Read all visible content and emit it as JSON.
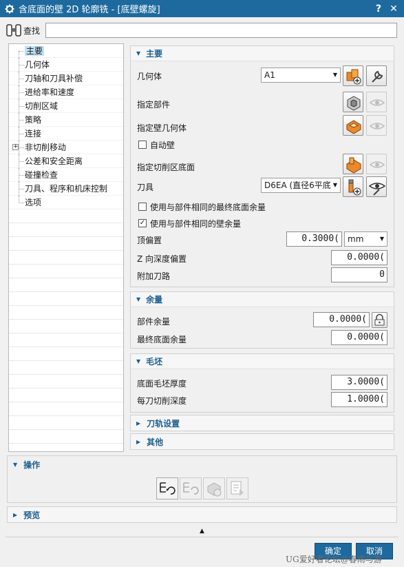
{
  "window": {
    "title": "含底面的壁 2D 轮廓铣 - [底壁螺旋]",
    "help_label": "?",
    "close_label": "✕",
    "gear_icon": "gear-icon"
  },
  "search": {
    "label": "查找",
    "value": ""
  },
  "nav": {
    "items": [
      {
        "label": "主要",
        "selected": true
      },
      {
        "label": "几何体"
      },
      {
        "label": "刀轴和刀具补偿"
      },
      {
        "label": "进给率和速度"
      },
      {
        "label": "切削区域"
      },
      {
        "label": "策略"
      },
      {
        "label": "连接"
      },
      {
        "label": "非切削移动",
        "expandable": true,
        "expander": "+"
      },
      {
        "label": "公差和安全距离"
      },
      {
        "label": "碰撞检查"
      },
      {
        "label": "刀具、程序和机床控制"
      },
      {
        "label": "选项"
      }
    ]
  },
  "main_section": {
    "title": "主要",
    "geometry_label": "几何体",
    "geometry_value": "A1",
    "specify_part_label": "指定部件",
    "specify_wall_label": "指定壁几何体",
    "auto_wall_label": "自动壁",
    "specify_floor_label": "指定切削区底面",
    "tool_label": "刀具",
    "tool_value": "D6EA (直径6平底",
    "same_floor_stock_label": "使用与部件相同的最终底面余量",
    "same_floor_stock_checked": false,
    "same_wall_stock_label": "使用与部件相同的壁余量",
    "same_wall_stock_checked": true,
    "check_mark": "✓",
    "top_offset_label": "顶偏置",
    "top_offset_value": "0.3000(",
    "top_offset_unit": "mm",
    "z_depth_label": "Z 向深度偏置",
    "z_depth_value": "0.0000(",
    "extra_paths_label": "附加刀路",
    "extra_paths_value": "0"
  },
  "stock_section": {
    "title": "余量",
    "part_stock_label": "部件余量",
    "part_stock_value": "0.0000(",
    "final_floor_stock_label": "最终底面余量",
    "final_floor_stock_value": "0.0000("
  },
  "blank_section": {
    "title": "毛坯",
    "floor_blank_label": "底面毛坯厚度",
    "floor_blank_value": "3.0000(",
    "depth_per_cut_label": "每刀切削深度",
    "depth_per_cut_value": "1.0000("
  },
  "toolpath_settings": {
    "title": "刀轨设置"
  },
  "other": {
    "title": "其他"
  },
  "actions": {
    "title": "操作"
  },
  "preview": {
    "title": "预览"
  },
  "footer": {
    "ok_label": "确定",
    "cancel_label": "取消",
    "collapse_arrow": "▲",
    "watermark": "UG爱好者论坛@春雨与游"
  },
  "colors": {
    "title_bar": "#1e6a9e",
    "section_header_text": "#1e5f8e",
    "selection": "#bfe0f6"
  }
}
